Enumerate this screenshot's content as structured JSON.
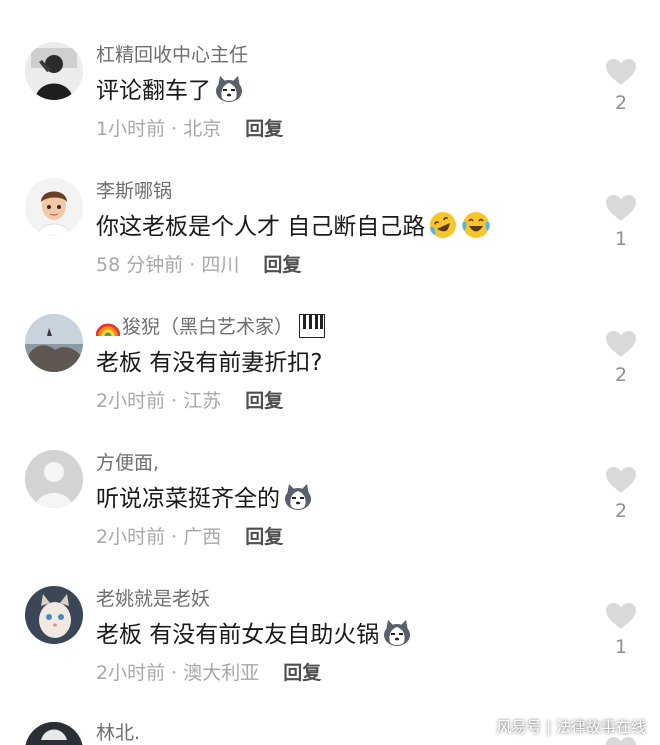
{
  "comments": [
    {
      "user": "杠精回收中心主任",
      "text": "评论翻车了",
      "time": "1小时前 · 北京",
      "reply": "回复",
      "likes": "2"
    },
    {
      "user": "李斯哪锅",
      "text": "你这老板是个人才 自己断自己路",
      "time": "58 分钟前 · 四川",
      "reply": "回复",
      "likes": "1"
    },
    {
      "user": "狻猊（黑白艺术家）",
      "text": "老板 有没有前妻折扣?",
      "time": "2小时前 · 江苏",
      "reply": "回复",
      "likes": "2"
    },
    {
      "user": "方便面,",
      "text": "听说凉菜挺齐全的",
      "time": "2小时前 · 广西",
      "reply": "回复",
      "likes": "2"
    },
    {
      "user": "老姚就是老妖",
      "text": "老板 有没有前女友自助火锅",
      "time": "2小时前 · 澳大利亚",
      "reply": "回复",
      "likes": "1"
    },
    {
      "user": "林北."
    }
  ],
  "watermark": "风易号 | 法律故事在线",
  "icons": {
    "like": "heart-icon",
    "emoji_husky": "husky-emoji",
    "emoji_laugh": "laugh-cry-emoji",
    "rainbow": "rainbow-emoji",
    "piano": "piano-emoji"
  },
  "colors": {
    "username": "#6f6f6f",
    "text": "#1a1a1a",
    "meta": "#a8a8a8",
    "heart": "#d9d9d9"
  }
}
